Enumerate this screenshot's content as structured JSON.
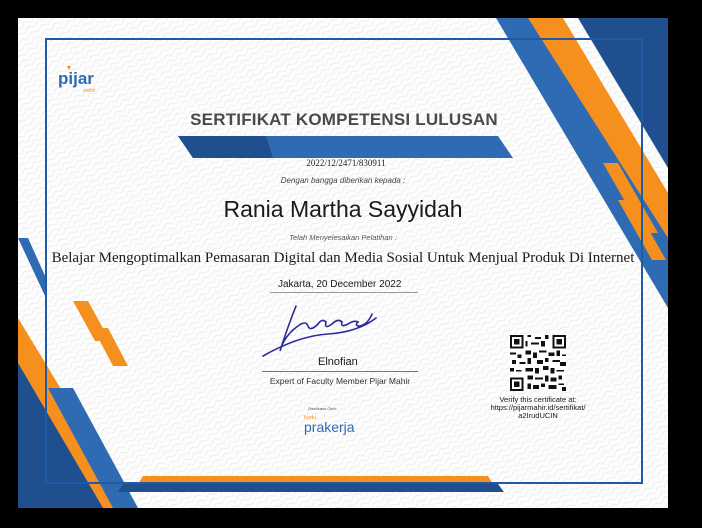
{
  "header": {
    "logo_text": "pijar",
    "logo_sub": "mahir"
  },
  "certificate": {
    "title": "SERTIFIKAT KOMPETENSI LULUSAN",
    "number": "2022/12/2471/830911",
    "intro": "Dengan bangga diberikan kepada :",
    "recipient": "Rania Martha Sayyidah",
    "completed_label": "Telah Menyelesaikan Pelatihan :",
    "course": "Belajar Mengoptimalkan Pemasaran Digital dan Media Sosial Untuk Menjual Produk Di Internet",
    "date": "Jakarta, 20 December 2022"
  },
  "signatory": {
    "name": "Elnofian",
    "title": "Expert of Faculty Member Pijar Mahir"
  },
  "sponsor": {
    "supported_by": "Diselikasa Oleh:",
    "logo_small": "kartu",
    "logo_main": "prakerja"
  },
  "verification": {
    "label": "Verify this certificate at:",
    "url": "https://pijarmahir.id/sertifikat/",
    "code": "a2IrudUCIN"
  },
  "colors": {
    "blue": "#2f6bb3",
    "navy": "#1f4f8e",
    "orange": "#f5901e",
    "frame": "#1f5aa6"
  }
}
